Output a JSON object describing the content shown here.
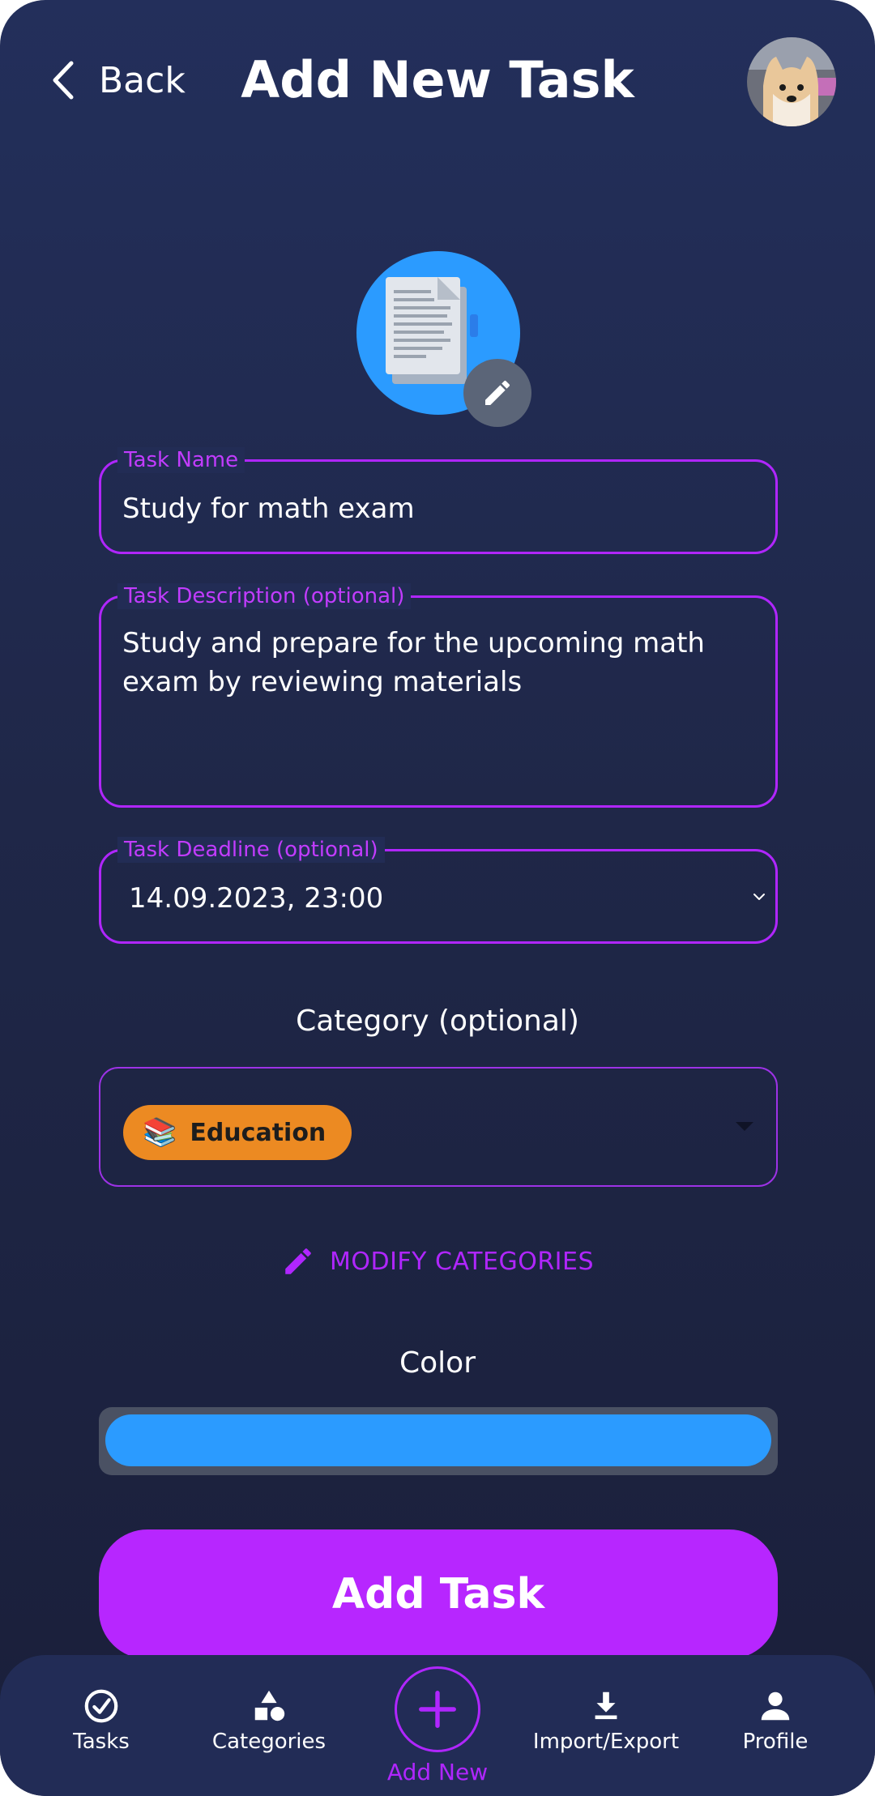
{
  "header": {
    "back_label": "Back",
    "title": "Add New Task"
  },
  "form": {
    "task_name": {
      "label": "Task Name",
      "value": "Study for math exam"
    },
    "task_description": {
      "label": "Task Description (optional)",
      "value_line1": "Study and prepare for the upcoming math",
      "value_line2": "exam by reviewing materials"
    },
    "task_deadline": {
      "label": "Task Deadline (optional)",
      "value": "14.09.2023, 23:00"
    },
    "category": {
      "heading": "Category (optional)",
      "selected_label": "Education",
      "selected_emoji": "📚",
      "selected_color": "#ec8a22"
    },
    "modify_categories": "MODIFY CATEGORIES",
    "color": {
      "heading": "Color",
      "value": "#2b9bff"
    },
    "submit_label": "Add Task"
  },
  "nav": {
    "items": [
      {
        "label": "Tasks",
        "icon": "check-circle-icon"
      },
      {
        "label": "Categories",
        "icon": "shapes-icon"
      },
      {
        "label": "Add New",
        "icon": "plus-circle-icon"
      },
      {
        "label": "Import/Export",
        "icon": "download-icon"
      },
      {
        "label": "Profile",
        "icon": "person-icon"
      }
    ]
  },
  "colors": {
    "accent": "#b726ff",
    "background": "#1f2748",
    "task_icon_bg": "#2b9bff"
  }
}
